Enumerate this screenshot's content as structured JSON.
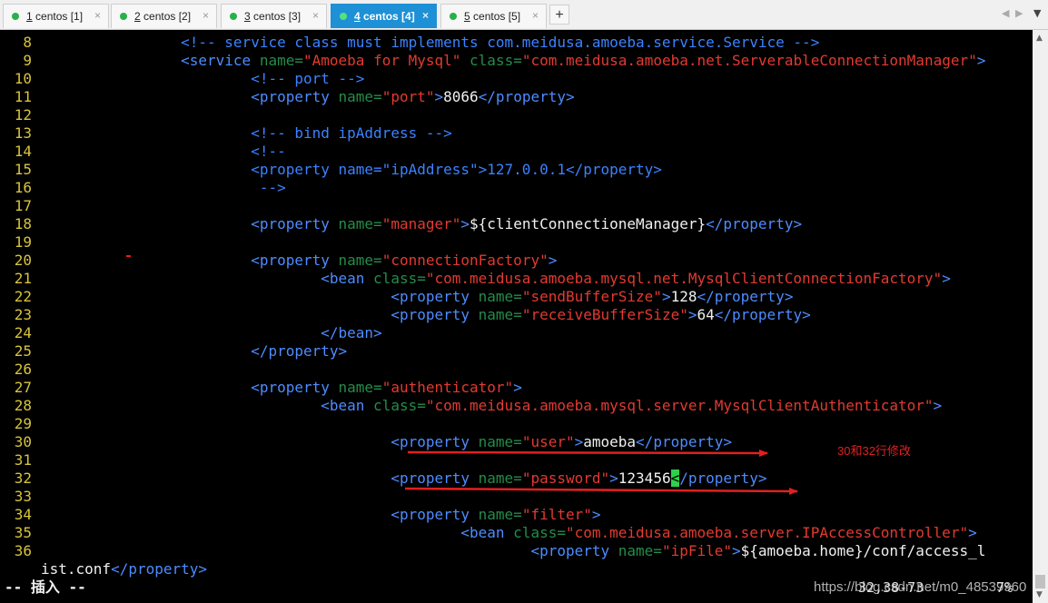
{
  "tabs": [
    {
      "num": "1",
      "label": " centos [1]",
      "active": false
    },
    {
      "num": "2",
      "label": " centos [2]",
      "active": false
    },
    {
      "num": "3",
      "label": " centos [3]",
      "active": false
    },
    {
      "num": "4",
      "label": " centos [4]",
      "active": true
    },
    {
      "num": "5",
      "label": " centos [5]",
      "active": false
    }
  ],
  "new_tab_label": "+",
  "lines": [
    {
      "n": "8",
      "segs": [
        [
          "sp",
          "                "
        ],
        [
          "cmt",
          "<!-- service class must implements com.meidusa.amoeba.service.Service -->"
        ]
      ]
    },
    {
      "n": "9",
      "segs": [
        [
          "sp",
          "                "
        ],
        [
          "tag",
          "<service "
        ],
        [
          "att",
          "name="
        ],
        [
          "str",
          "\"Amoeba for Mysql\" "
        ],
        [
          "att",
          "class="
        ],
        [
          "str",
          "\"com.meidusa.amoeba.net.ServerableConnectionManager\""
        ],
        [
          "tag",
          ">"
        ]
      ]
    },
    {
      "n": "10",
      "segs": [
        [
          "sp",
          "                        "
        ],
        [
          "cmt",
          "<!-- port -->"
        ]
      ]
    },
    {
      "n": "11",
      "segs": [
        [
          "sp",
          "                        "
        ],
        [
          "tag",
          "<property "
        ],
        [
          "att",
          "name="
        ],
        [
          "str",
          "\"port\""
        ],
        [
          "tag",
          ">"
        ],
        [
          "txt",
          "8066"
        ],
        [
          "tag",
          "</property>"
        ]
      ]
    },
    {
      "n": "12",
      "segs": []
    },
    {
      "n": "13",
      "segs": [
        [
          "sp",
          "                        "
        ],
        [
          "cmt",
          "<!-- bind ipAddress -->"
        ]
      ]
    },
    {
      "n": "14",
      "segs": [
        [
          "sp",
          "                        "
        ],
        [
          "cmt",
          "<!--"
        ]
      ]
    },
    {
      "n": "15",
      "segs": [
        [
          "sp",
          "                        "
        ],
        [
          "cmt",
          "<property name=\"ipAddress\">127.0.0.1</property>"
        ]
      ]
    },
    {
      "n": "16",
      "segs": [
        [
          "sp",
          "                         "
        ],
        [
          "cmt",
          "-->"
        ]
      ]
    },
    {
      "n": "17",
      "segs": []
    },
    {
      "n": "18",
      "segs": [
        [
          "sp",
          "                        "
        ],
        [
          "tag",
          "<property "
        ],
        [
          "att",
          "name="
        ],
        [
          "str",
          "\"manager\""
        ],
        [
          "tag",
          ">"
        ],
        [
          "txt",
          "${clientConnectioneManager}"
        ],
        [
          "tag",
          "</property>"
        ]
      ]
    },
    {
      "n": "19",
      "segs": []
    },
    {
      "n": "20",
      "segs": [
        [
          "sp",
          "                        "
        ],
        [
          "tag",
          "<property "
        ],
        [
          "att",
          "name="
        ],
        [
          "str",
          "\"connectionFactory\""
        ],
        [
          "tag",
          ">"
        ]
      ]
    },
    {
      "n": "21",
      "segs": [
        [
          "sp",
          "                                "
        ],
        [
          "tag",
          "<bean "
        ],
        [
          "att",
          "class="
        ],
        [
          "str",
          "\"com.meidusa.amoeba.mysql.net.MysqlClientConnectionFactory\""
        ],
        [
          "tag",
          ">"
        ]
      ]
    },
    {
      "n": "22",
      "segs": [
        [
          "sp",
          "                                        "
        ],
        [
          "tag",
          "<property "
        ],
        [
          "att",
          "name="
        ],
        [
          "str",
          "\"sendBufferSize\""
        ],
        [
          "tag",
          ">"
        ],
        [
          "txt",
          "128"
        ],
        [
          "tag",
          "</property>"
        ]
      ]
    },
    {
      "n": "23",
      "segs": [
        [
          "sp",
          "                                        "
        ],
        [
          "tag",
          "<property "
        ],
        [
          "att",
          "name="
        ],
        [
          "str",
          "\"receiveBufferSize\""
        ],
        [
          "tag",
          ">"
        ],
        [
          "txt",
          "64"
        ],
        [
          "tag",
          "</property>"
        ]
      ]
    },
    {
      "n": "24",
      "segs": [
        [
          "sp",
          "                                "
        ],
        [
          "tag",
          "</bean>"
        ]
      ]
    },
    {
      "n": "25",
      "segs": [
        [
          "sp",
          "                        "
        ],
        [
          "tag",
          "</property>"
        ]
      ]
    },
    {
      "n": "26",
      "segs": []
    },
    {
      "n": "27",
      "segs": [
        [
          "sp",
          "                        "
        ],
        [
          "tag",
          "<property "
        ],
        [
          "att",
          "name="
        ],
        [
          "str",
          "\"authenticator\""
        ],
        [
          "tag",
          ">"
        ]
      ]
    },
    {
      "n": "28",
      "segs": [
        [
          "sp",
          "                                "
        ],
        [
          "tag",
          "<bean "
        ],
        [
          "att",
          "class="
        ],
        [
          "str",
          "\"com.meidusa.amoeba.mysql.server.MysqlClientAuthenticator\""
        ],
        [
          "tag",
          ">"
        ]
      ]
    },
    {
      "n": "29",
      "segs": []
    },
    {
      "n": "30",
      "segs": [
        [
          "sp",
          "                                        "
        ],
        [
          "tag",
          "<property "
        ],
        [
          "att",
          "name="
        ],
        [
          "str",
          "\"user\""
        ],
        [
          "tag",
          ">"
        ],
        [
          "txt",
          "amoeba"
        ],
        [
          "tag",
          "</property>"
        ]
      ]
    },
    {
      "n": "31",
      "segs": []
    },
    {
      "n": "32",
      "segs": [
        [
          "sp",
          "                                        "
        ],
        [
          "tag",
          "<property "
        ],
        [
          "att",
          "name="
        ],
        [
          "str",
          "\"password\""
        ],
        [
          "tag",
          ">"
        ],
        [
          "txt",
          "123456"
        ],
        [
          "cursor",
          "<"
        ],
        [
          "tag",
          "/property>"
        ]
      ]
    },
    {
      "n": "33",
      "segs": []
    },
    {
      "n": "34",
      "segs": [
        [
          "sp",
          "                                        "
        ],
        [
          "tag",
          "<property "
        ],
        [
          "att",
          "name="
        ],
        [
          "str",
          "\"filter\""
        ],
        [
          "tag",
          ">"
        ]
      ]
    },
    {
      "n": "35",
      "segs": [
        [
          "sp",
          "                                                "
        ],
        [
          "tag",
          "<bean "
        ],
        [
          "att",
          "class="
        ],
        [
          "str",
          "\"com.meidusa.amoeba.server.IPAccessController\""
        ],
        [
          "tag",
          ">"
        ]
      ]
    },
    {
      "n": "36",
      "segs": [
        [
          "sp",
          "                                                        "
        ],
        [
          "tag",
          "<property "
        ],
        [
          "att",
          "name="
        ],
        [
          "str",
          "\"ipFile\""
        ],
        [
          "tag",
          ">"
        ],
        [
          "txt",
          "${amoeba.home}/conf/access_l"
        ]
      ]
    },
    {
      "n": "",
      "segs": [
        [
          "txt",
          "ist.conf"
        ],
        [
          "tag",
          "</property>"
        ]
      ]
    }
  ],
  "status": {
    "mode": "-- 插入 --",
    "position": "32,38-73",
    "percent": "7%",
    "watermark": "https://blog.csdn.net/m0_48539960"
  },
  "annotation": "30和32行修改",
  "colors": {
    "tag": "#4d8cff",
    "attr": "#258c4a",
    "string": "#e23a30",
    "text": "#f0f0f0",
    "line_number": "#d8c43a",
    "arrow": "#e02020",
    "cursor": "#2fd14a",
    "active_tab": "#1e90d6"
  }
}
